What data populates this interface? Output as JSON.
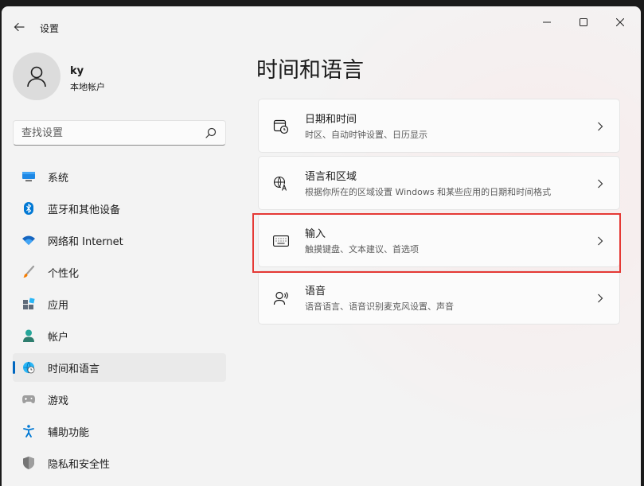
{
  "window": {
    "title": "设置",
    "controls": {
      "minimize": "—",
      "maximize": "☐",
      "close": "✕"
    }
  },
  "user": {
    "name": "ky",
    "account_type": "本地帐户"
  },
  "search": {
    "placeholder": "查找设置"
  },
  "nav": {
    "items": [
      {
        "label": "系统",
        "icon": "monitor-icon",
        "active": false
      },
      {
        "label": "蓝牙和其他设备",
        "icon": "bluetooth-icon",
        "active": false
      },
      {
        "label": "网络和 Internet",
        "icon": "wifi-icon",
        "active": false
      },
      {
        "label": "个性化",
        "icon": "brush-icon",
        "active": false
      },
      {
        "label": "应用",
        "icon": "apps-icon",
        "active": false
      },
      {
        "label": "帐户",
        "icon": "person-icon",
        "active": false
      },
      {
        "label": "时间和语言",
        "icon": "globe-clock-icon",
        "active": true
      },
      {
        "label": "游戏",
        "icon": "gamepad-icon",
        "active": false
      },
      {
        "label": "辅助功能",
        "icon": "accessibility-icon",
        "active": false
      },
      {
        "label": "隐私和安全性",
        "icon": "shield-icon",
        "active": false
      }
    ]
  },
  "main": {
    "title": "时间和语言",
    "cards": [
      {
        "title": "日期和时间",
        "subtitle": "时区、自动时钟设置、日历显示",
        "icon": "calendar-clock-icon"
      },
      {
        "title": "语言和区域",
        "subtitle": "根据你所在的区域设置 Windows 和某些应用的日期和时间格式",
        "icon": "language-icon"
      },
      {
        "title": "输入",
        "subtitle": "触摸键盘、文本建议、首选项",
        "icon": "keyboard-icon",
        "highlighted": true
      },
      {
        "title": "语音",
        "subtitle": "语音语言、语音识别麦克风设置、声音",
        "icon": "speech-icon"
      }
    ]
  },
  "colors": {
    "accent": "#0067c0",
    "highlight_border": "#e53935",
    "background": "#f3f3f3"
  }
}
